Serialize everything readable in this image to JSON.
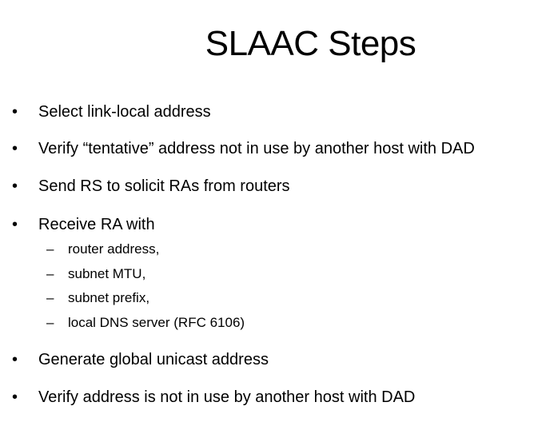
{
  "slide": {
    "title": "SLAAC Steps",
    "bullet_symbol": "•",
    "sub_bullet_symbol": "–",
    "bullets": [
      {
        "text": "Select link-local address"
      },
      {
        "text": "Verify “tentative” address not in use by another host with DAD"
      },
      {
        "text": "Send RS to solicit RAs from routers"
      },
      {
        "text": "Receive RA with",
        "sub_items": [
          "router address,",
          "subnet MTU,",
          "subnet prefix,",
          "local DNS server (RFC 6106)"
        ]
      },
      {
        "text": "Generate global unicast address"
      },
      {
        "text": "Verify address is not in use by another host with DAD"
      }
    ]
  }
}
